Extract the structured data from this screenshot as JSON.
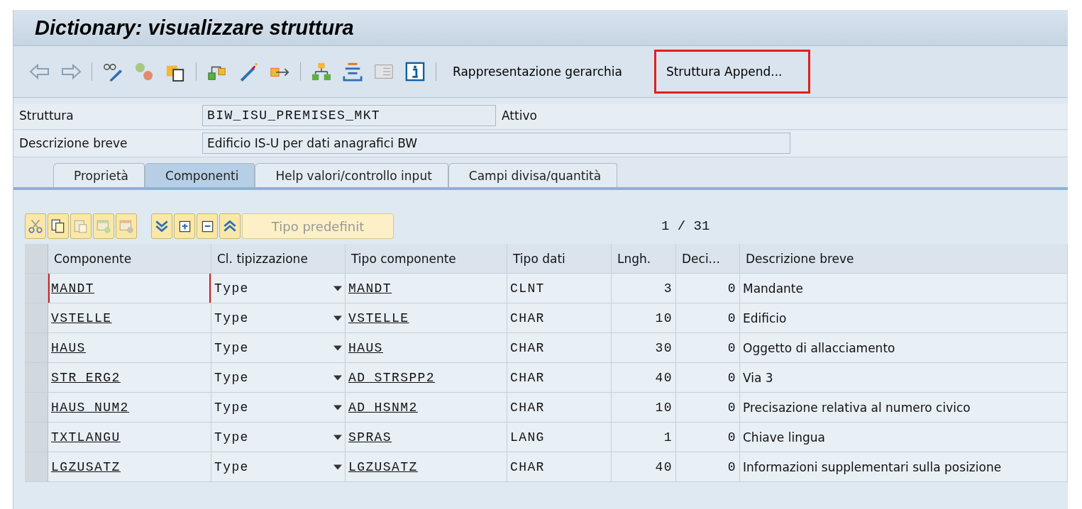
{
  "window": {
    "title": "Dictionary: visualizzare struttura"
  },
  "toolbar": {
    "buttons": [
      {
        "label": "Rappresentazione gerarchia",
        "highlighted": false
      },
      {
        "label": "Struttura Append...",
        "highlighted": true
      }
    ]
  },
  "fields": [
    {
      "label": "Struttura",
      "kind": "code",
      "value": "BIW_ISU_PREMISES_MKT",
      "status": "Attivo"
    },
    {
      "label": "Descrizione breve",
      "kind": "text",
      "value": "Edificio IS-U per dati anagrafici BW"
    }
  ],
  "tabs": [
    {
      "label": "Proprietà",
      "selected": false
    },
    {
      "label": "Componenti",
      "selected": true
    },
    {
      "label": "Help valori/controllo input",
      "selected": false
    },
    {
      "label": "Campi divisa/quantità",
      "selected": false
    }
  ],
  "table_toolbar": {
    "button": {
      "label": "Tipo predefinit",
      "disabled": true
    },
    "counter": "1 / 31"
  },
  "table": {
    "columns": [
      {
        "label": "Componente",
        "kind": "link"
      },
      {
        "label": "Cl. tipizzazione",
        "kind": "select"
      },
      {
        "label": "Tipo componente",
        "kind": "link"
      },
      {
        "label": "Tipo dati",
        "kind": "code"
      },
      {
        "label": "Lngh.",
        "kind": "number"
      },
      {
        "label": "Deci...",
        "kind": "number"
      },
      {
        "label": "Descrizione breve",
        "kind": "text"
      }
    ],
    "rows": [
      {
        "focused": true,
        "cells": [
          "MANDT",
          "Type",
          "MANDT",
          "CLNT",
          "3",
          "0",
          "Mandante"
        ]
      },
      {
        "focused": false,
        "cells": [
          "VSTELLE",
          "Type",
          "VSTELLE",
          "CHAR",
          "10",
          "0",
          "Edificio"
        ]
      },
      {
        "focused": false,
        "cells": [
          "HAUS",
          "Type",
          "HAUS",
          "CHAR",
          "30",
          "0",
          "Oggetto di allacciamento"
        ]
      },
      {
        "focused": false,
        "cells": [
          "STR_ERG2",
          "Type",
          "AD_STRSPP2",
          "CHAR",
          "40",
          "0",
          "Via 3"
        ]
      },
      {
        "focused": false,
        "cells": [
          "HAUS_NUM2",
          "Type",
          "AD_HSNM2",
          "CHAR",
          "10",
          "0",
          "Precisazione relativa al numero civico"
        ]
      },
      {
        "focused": false,
        "cells": [
          "TXTLANGU",
          "Type",
          "SPRAS",
          "LANG",
          "1",
          "0",
          "Chiave lingua"
        ]
      },
      {
        "focused": false,
        "cells": [
          "LGZUSATZ",
          "Type",
          "LGZUSATZ",
          "CHAR",
          "40",
          "0",
          "Informazioni supplementari sulla posizione"
        ]
      }
    ]
  }
}
